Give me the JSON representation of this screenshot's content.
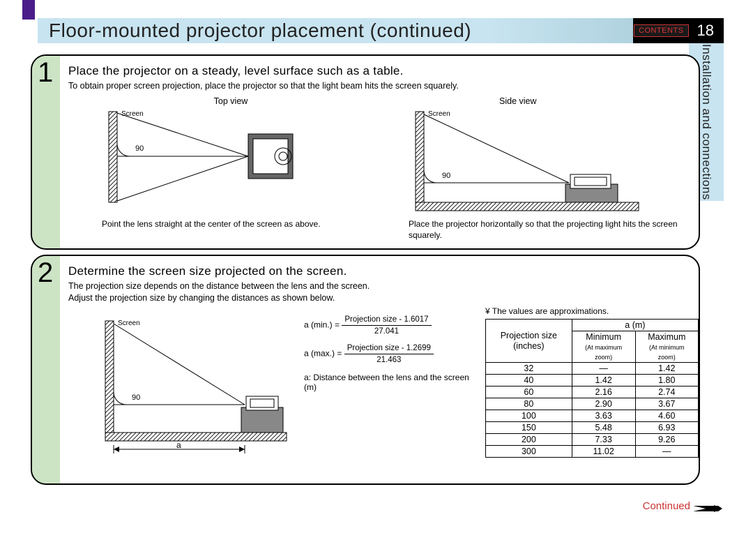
{
  "header": {
    "title": "Floor-mounted projector placement (continued)",
    "contents_btn": "CONTENTS",
    "page_number": "18"
  },
  "section_tab": "Installation and connections",
  "step1": {
    "number": "1",
    "heading": "Place the projector on a steady, level surface such as a table.",
    "sub": "To obtain proper screen projection, place the projector so that the light beam hits the screen squarely.",
    "top_view": "Top view",
    "side_view": "Side view",
    "screen_label": "Screen",
    "angle": "90",
    "caption_left": "Point the lens straight at the center of the screen as above.",
    "caption_right": "Place the projector horizontally so that the projecting light hits the screen squarely."
  },
  "step2": {
    "number": "2",
    "heading": "Determine the screen size projected on the screen.",
    "sub": "The projection size depends on the distance between the lens and the screen.\nAdjust the projection size by changing the distances as shown below.",
    "screen_label": "Screen",
    "angle": "90",
    "a_label": "a",
    "formula_amin_label": "a (min.) =",
    "formula_amin_top": "Projection size - 1.6017",
    "formula_amin_bot": "27.041",
    "formula_amax_label": "a (max.) =",
    "formula_amax_top": "Projection size - 1.2699",
    "formula_amax_bot": "21.463",
    "formula_note": "a: Distance between the lens and the screen (m)",
    "approx_note": "¥ The values are approximations.",
    "table": {
      "am_header": "a (m)",
      "col1": "Projection size (inches)",
      "col2": "Minimum",
      "col2_sub": "(At maximum zoom)",
      "col3": "Maximum",
      "col3_sub": "(At minimum zoom)",
      "rows": [
        {
          "size": "32",
          "min": "—",
          "max": "1.42"
        },
        {
          "size": "40",
          "min": "1.42",
          "max": "1.80"
        },
        {
          "size": "60",
          "min": "2.16",
          "max": "2.74"
        },
        {
          "size": "80",
          "min": "2.90",
          "max": "3.67"
        },
        {
          "size": "100",
          "min": "3.63",
          "max": "4.60"
        },
        {
          "size": "150",
          "min": "5.48",
          "max": "6.93"
        },
        {
          "size": "200",
          "min": "7.33",
          "max": "9.26"
        },
        {
          "size": "300",
          "min": "11.02",
          "max": "—"
        }
      ]
    }
  },
  "continued": "Continued",
  "chart_data": {
    "type": "table",
    "title": "Projection distance a (m) vs Projection size (inches)",
    "columns": [
      "Projection size (inches)",
      "Minimum a (m) at max zoom",
      "Maximum a (m) at min zoom"
    ],
    "rows": [
      [
        32,
        null,
        1.42
      ],
      [
        40,
        1.42,
        1.8
      ],
      [
        60,
        2.16,
        2.74
      ],
      [
        80,
        2.9,
        3.67
      ],
      [
        100,
        3.63,
        4.6
      ],
      [
        150,
        5.48,
        6.93
      ],
      [
        200,
        7.33,
        9.26
      ],
      [
        300,
        11.02,
        null
      ]
    ]
  }
}
